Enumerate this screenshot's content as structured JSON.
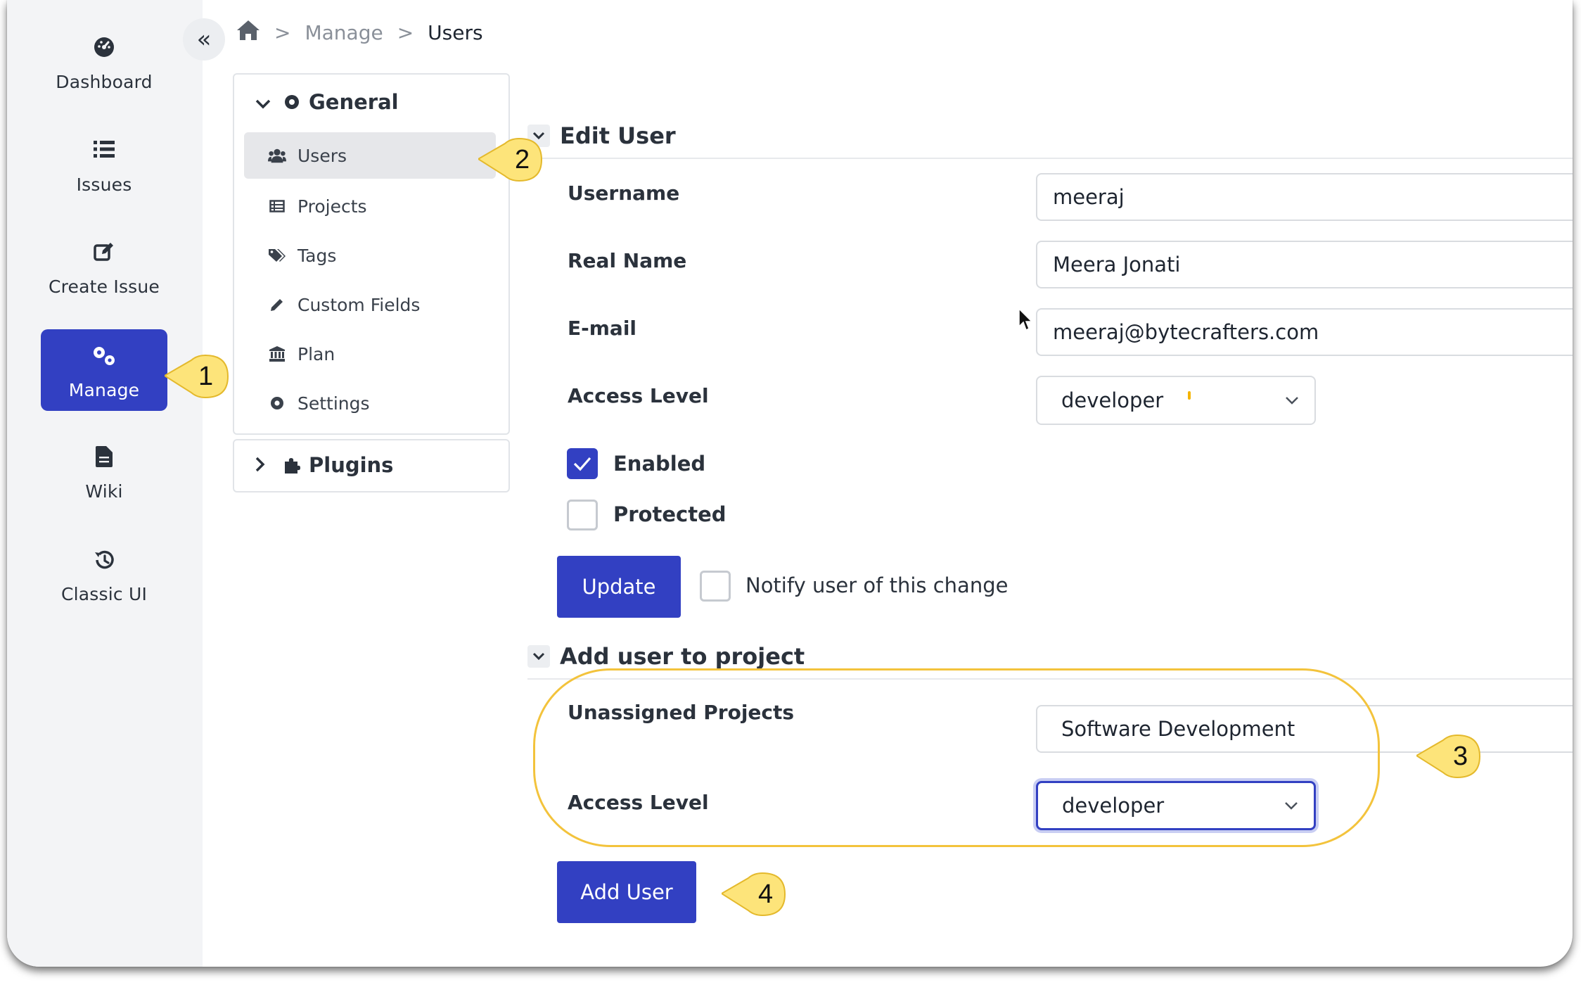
{
  "nav": {
    "items": [
      {
        "label": "Dashboard",
        "icon": "dashboard-icon"
      },
      {
        "label": "Issues",
        "icon": "list-icon"
      },
      {
        "label": "Create Issue",
        "icon": "edit-icon"
      },
      {
        "label": "Manage",
        "icon": "gears-icon",
        "active": true
      },
      {
        "label": "Wiki",
        "icon": "document-icon"
      },
      {
        "label": "Classic UI",
        "icon": "history-icon"
      }
    ],
    "collapse_icon": "double-chevron-left-icon"
  },
  "breadcrumb": {
    "home_icon": "home-icon",
    "items": [
      "Manage",
      "Users"
    ]
  },
  "side_menu": {
    "general": {
      "title": "General",
      "items": [
        {
          "label": "Users",
          "icon": "users-icon",
          "active": true
        },
        {
          "label": "Projects",
          "icon": "table-icon"
        },
        {
          "label": "Tags",
          "icon": "tags-icon"
        },
        {
          "label": "Custom Fields",
          "icon": "pencil-icon"
        },
        {
          "label": "Plan",
          "icon": "bank-icon"
        },
        {
          "label": "Settings",
          "icon": "gear-icon"
        }
      ]
    },
    "plugins": {
      "title": "Plugins"
    }
  },
  "edit_user": {
    "title": "Edit User",
    "username_label": "Username",
    "username_value": "meeraj",
    "realname_label": "Real Name",
    "realname_value": "Meera Jonati",
    "email_label": "E-mail",
    "email_value": "meeraj@bytecrafters.com",
    "access_label": "Access Level",
    "access_value": "developer",
    "enabled_label": "Enabled",
    "enabled_checked": true,
    "protected_label": "Protected",
    "protected_checked": false,
    "update_label": "Update",
    "notify_label": "Notify user of this change",
    "notify_checked": false
  },
  "add_to_project": {
    "title": "Add user to project",
    "unassigned_label": "Unassigned Projects",
    "unassigned_value": "Software Development",
    "access_label": "Access Level",
    "access_value": "developer",
    "add_label": "Add User"
  },
  "callouts": [
    "1",
    "2",
    "3",
    "4"
  ],
  "colors": {
    "primary": "#3240c2",
    "callout": "#fde47a",
    "highlight": "#f3c33c"
  }
}
